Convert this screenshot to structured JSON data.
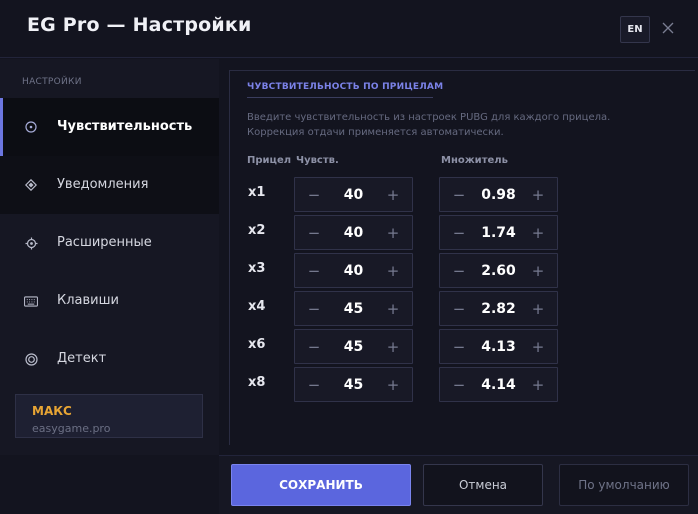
{
  "window": {
    "title": "EG Pro — Настройки",
    "lang_button": "EN",
    "close_icon": "close-icon"
  },
  "sidebar": {
    "heading": "НАСТРОЙКИ",
    "items": [
      {
        "label": "Чувствительность",
        "icon": "crosshair-icon",
        "active": true
      },
      {
        "label": "Уведомления",
        "icon": "diamond-icon",
        "active": false
      },
      {
        "label": "Расширенные",
        "icon": "gear-icon",
        "active": false
      },
      {
        "label": "Клавиши",
        "icon": "keyboard-icon",
        "active": false
      },
      {
        "label": "Детект",
        "icon": "target-icon",
        "active": false
      }
    ],
    "account": {
      "name": "МАКС",
      "site": "easygame.pro"
    }
  },
  "main": {
    "section_title": "ЧУВСТВИТЕЛЬНОСТЬ ПО ПРИЦЕЛАМ",
    "description": "Введите чувствительность из настроек PUBG для каждого прицела. Коррекция отдачи применяется автоматически.",
    "columns": {
      "scope": "Прицел",
      "sens": "Чувств.",
      "mult": "Множитель"
    },
    "minus_symbol": "−",
    "plus_symbol": "+",
    "rows": [
      {
        "scope": "x1",
        "sens": "40",
        "mult": "0.98"
      },
      {
        "scope": "x2",
        "sens": "40",
        "mult": "1.74"
      },
      {
        "scope": "x3",
        "sens": "40",
        "mult": "2.60"
      },
      {
        "scope": "x4",
        "sens": "45",
        "mult": "2.82"
      },
      {
        "scope": "x6",
        "sens": "45",
        "mult": "4.13"
      },
      {
        "scope": "x8",
        "sens": "45",
        "mult": "4.14"
      }
    ]
  },
  "footer": {
    "save_label": "СОХРАНИТЬ",
    "cancel_label": "Отмена",
    "default_label": "По умолчанию"
  },
  "colors": {
    "accent": "#5b66de",
    "account_name": "#e8a534",
    "section_title": "#7b82e8"
  }
}
